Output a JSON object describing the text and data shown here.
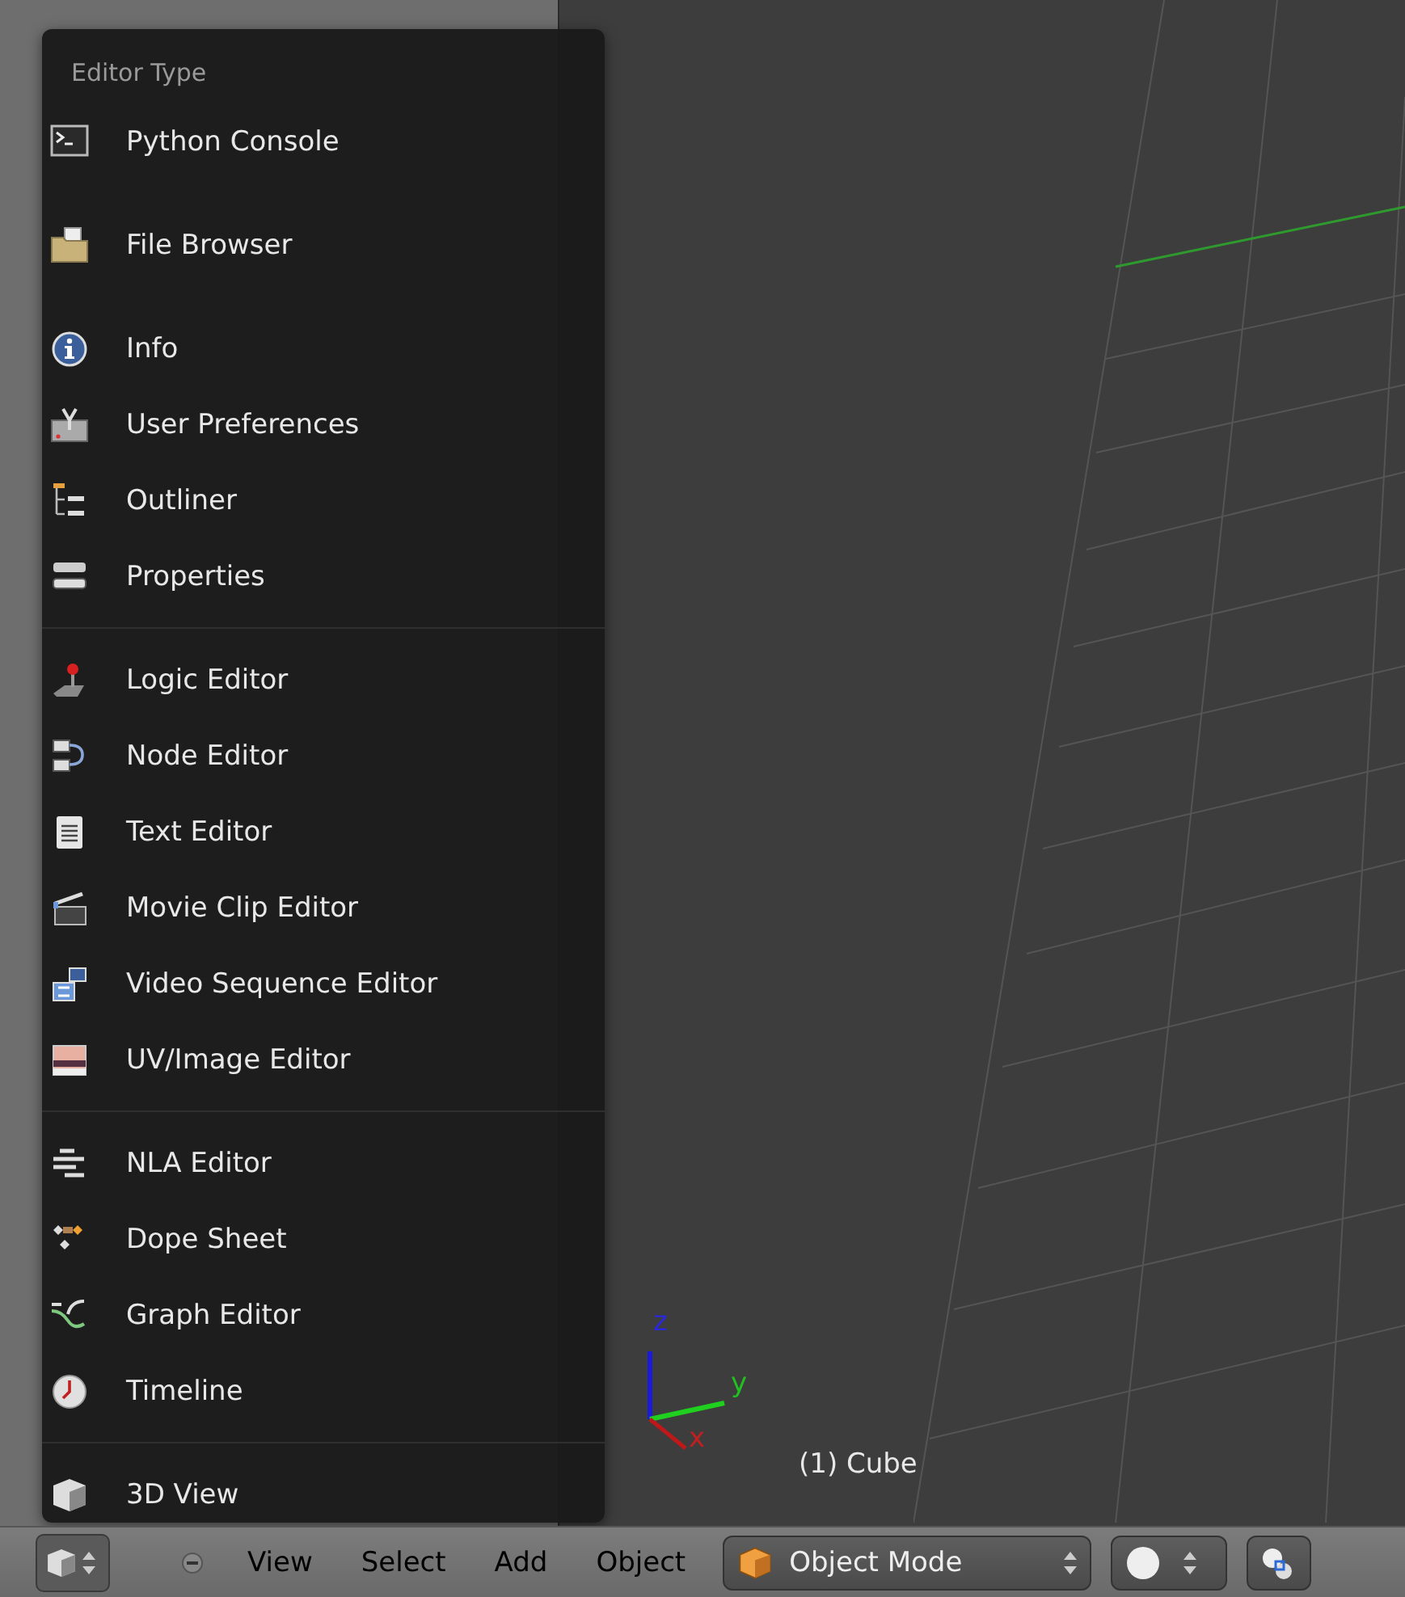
{
  "menu": {
    "title": "Editor Type",
    "sections": [
      {
        "items": [
          {
            "label": "Python Console",
            "kind": "console"
          },
          {
            "label": "File Browser",
            "kind": "folder"
          },
          {
            "label": "Info",
            "kind": "info"
          },
          {
            "label": "User Preferences",
            "kind": "prefs"
          },
          {
            "label": "Outliner",
            "kind": "outliner"
          },
          {
            "label": "Properties",
            "kind": "properties"
          }
        ]
      },
      {
        "items": [
          {
            "label": "Logic Editor",
            "kind": "joystick"
          },
          {
            "label": "Node Editor",
            "kind": "nodes"
          },
          {
            "label": "Text Editor",
            "kind": "text"
          },
          {
            "label": "Movie Clip Editor",
            "kind": "clapper"
          },
          {
            "label": "Video Sequence Editor",
            "kind": "film"
          },
          {
            "label": "UV/Image Editor",
            "kind": "image"
          }
        ]
      },
      {
        "items": [
          {
            "label": "NLA Editor",
            "kind": "nla"
          },
          {
            "label": "Dope Sheet",
            "kind": "dope"
          },
          {
            "label": "Graph Editor",
            "kind": "graph"
          },
          {
            "label": "Timeline",
            "kind": "clock"
          }
        ]
      },
      {
        "items": [
          {
            "label": "3D View",
            "kind": "cube"
          }
        ]
      }
    ]
  },
  "viewport": {
    "object_label": "(1) Cube",
    "axes": {
      "x": "x",
      "y": "y",
      "z": "z"
    }
  },
  "header": {
    "menus": [
      "View",
      "Select",
      "Add",
      "Object"
    ],
    "mode": "Object Mode"
  }
}
